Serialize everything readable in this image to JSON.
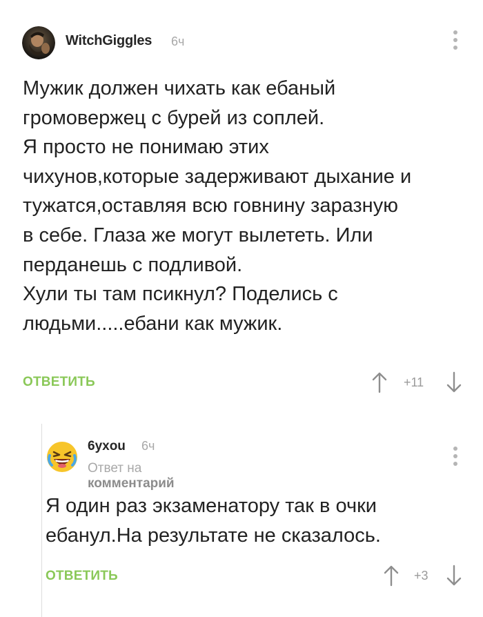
{
  "comments": [
    {
      "author": "WitchGiggles",
      "time": "6ч",
      "avatar": "bearded-man-avatar",
      "body_lines": [
        "Мужик должен чихать как ебаный",
        "громовержец с бурей из соплей.",
        "Я просто не понимаю этих",
        "чихунов,которые задерживают дыхание и",
        "тужатся,оставляя всю говнину заразную",
        "в себе. Глаза же могут вылететь. Или",
        "перданешь с подливой.",
        "Хули ты там псикнул? Поделись с",
        "людьми.....ебани как мужик."
      ],
      "reply_label": "ОТВЕТИТЬ",
      "score": "+11",
      "icons": {
        "menu": "more-vertical-icon",
        "up": "arrow-up-icon",
        "down": "arrow-down-icon"
      }
    },
    {
      "author": "6yxou",
      "time": "6ч",
      "avatar": "laughing-crying-emoji-avatar",
      "reply_to_prefix": "Ответ на",
      "reply_to_target": "комментарий",
      "body_lines": [
        "Я один раз экзаменатору так в очки",
        "ебанул.На результате не сказалось."
      ],
      "reply_label": "ОТВЕТИТЬ",
      "score": "+3",
      "icons": {
        "menu": "more-vertical-icon",
        "up": "arrow-up-icon",
        "down": "arrow-down-icon"
      }
    }
  ],
  "colors": {
    "accent_green": "#8ac858",
    "muted_text": "#a8a8a8",
    "thread_line": "#dcdcdc"
  }
}
